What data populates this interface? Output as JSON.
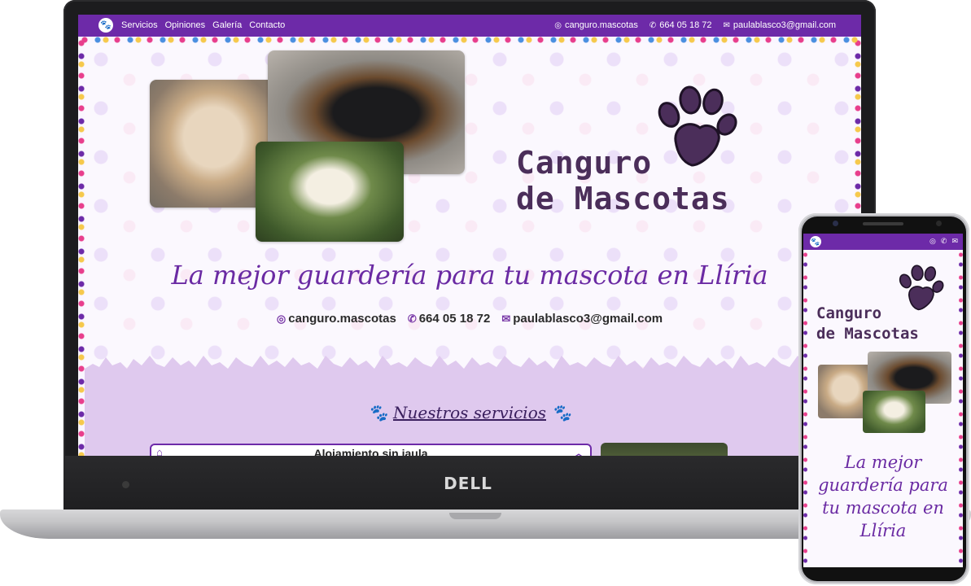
{
  "desktop": {
    "nav": {
      "logo_icon": "paw-icon",
      "links": [
        "Servicios",
        "Opiniones",
        "Galería",
        "Contacto"
      ],
      "instagram": "canguro.mascotas",
      "phone": "664 05 18 72",
      "email": "paulablasco3@gmail.com"
    },
    "hero": {
      "brand_line1": "Canguro",
      "brand_line2": "de Mascotas",
      "tagline": "La mejor guardería para tu mascota en Llíria",
      "contacts": {
        "instagram": "canguro.mascotas",
        "phone": "664 05 18 72",
        "email": "paulablasco3@gmail.com"
      }
    },
    "services": {
      "title": "Nuestros servicios",
      "accordion_first": "Alojamiento sin jaula"
    }
  },
  "laptop": {
    "brand": "DELL"
  },
  "mobile": {
    "brand_line1": "Canguro",
    "brand_line2": "de Mascotas",
    "tagline": "La mejor guardería para tu mascota en Llíria"
  },
  "colors": {
    "primary": "#6d2aa8",
    "brand_text": "#4b2e5a",
    "lilac": "#dfc9ee"
  }
}
